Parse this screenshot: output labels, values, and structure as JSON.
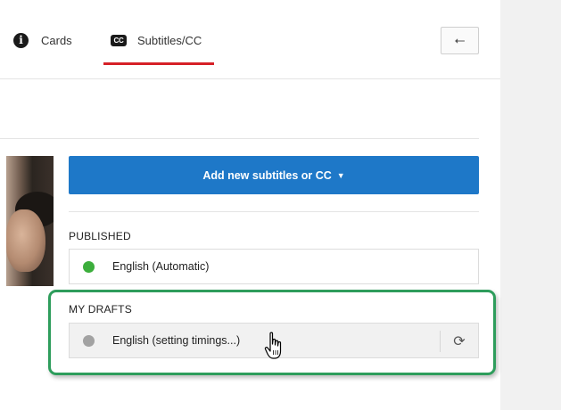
{
  "tabs": [
    {
      "label": "Cards",
      "icon": "info-icon"
    },
    {
      "label": "Subtitles/CC",
      "icon": "cc-icon",
      "icon_text": "CC",
      "active": true
    }
  ],
  "header": {
    "back_icon": "back-arrow-icon",
    "back_glyph": "⭠"
  },
  "add_button": {
    "label": "Add new subtitles or CC",
    "caret": "▼"
  },
  "published": {
    "heading": "PUBLISHED",
    "items": [
      {
        "label": "English (Automatic)",
        "status_color": "#3cae3c"
      }
    ]
  },
  "drafts": {
    "heading": "MY DRAFTS",
    "items": [
      {
        "label": "English (setting timings...)",
        "status_color": "#a2a2a2",
        "action_icon": "refresh-icon",
        "action_glyph": "⟳"
      }
    ]
  },
  "colors": {
    "accent_red": "#d62027",
    "button_blue": "#1e78c8",
    "highlight_green": "#2e9d5c"
  }
}
